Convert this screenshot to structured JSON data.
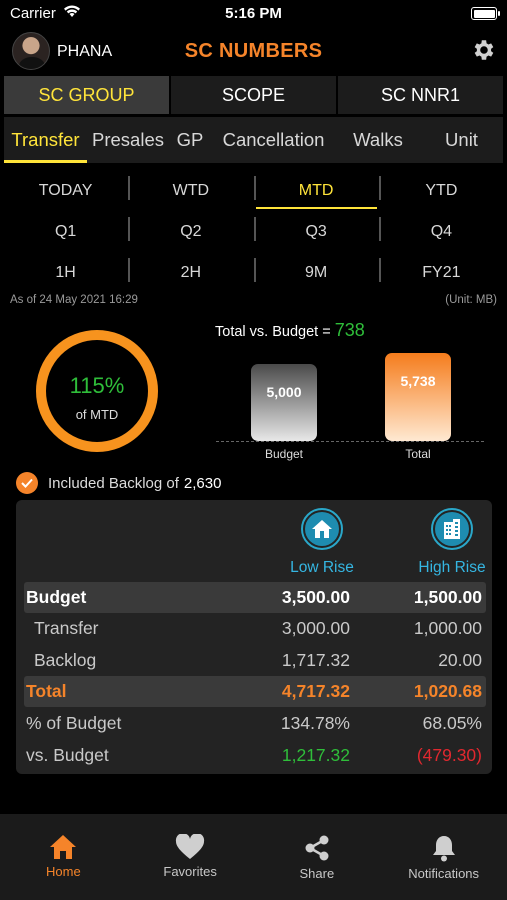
{
  "status_bar": {
    "carrier": "Carrier",
    "time": "5:16 PM"
  },
  "header": {
    "username": "PHANA",
    "title": "SC NUMBERS"
  },
  "group_tabs": [
    "SC GROUP",
    "SCOPE",
    "SC NNR1"
  ],
  "category_tabs": [
    "Transfer",
    "Presales",
    "GP",
    "Cancellation",
    "Walks",
    "Unit"
  ],
  "periods": [
    [
      "TODAY",
      "WTD",
      "MTD",
      "YTD"
    ],
    [
      "Q1",
      "Q2",
      "Q3",
      "Q4"
    ],
    [
      "1H",
      "2H",
      "9M",
      "FY21"
    ]
  ],
  "selected": {
    "group_tab": "SC GROUP",
    "category_tab": "Transfer",
    "period": "MTD"
  },
  "as_of": "As of 24 May 2021 16:29",
  "unit_note": "(Unit: MB)",
  "ring": {
    "percent": "115%",
    "label": "of MTD",
    "value": 1.15
  },
  "total_vs_budget": {
    "label": "Total vs. Budget = ",
    "value": "738"
  },
  "bars": {
    "budget": {
      "label": "Budget",
      "value": "5,000",
      "amount": 5000
    },
    "total": {
      "label": "Total",
      "value": "5,738",
      "amount": 5738
    }
  },
  "backlog_check": {
    "label": "Included Backlog of",
    "value": "2,630",
    "checked": true
  },
  "table": {
    "columns": [
      {
        "label": "Low Rise",
        "icon": "house-icon"
      },
      {
        "label": "High Rise",
        "icon": "building-icon"
      }
    ],
    "rows": [
      {
        "label": "Budget",
        "low": "3,500.00",
        "high": "1,500.00"
      },
      {
        "label": "Transfer",
        "low": "3,000.00",
        "high": "1,000.00"
      },
      {
        "label": "Backlog",
        "low": "1,717.32",
        "high": "20.00"
      },
      {
        "label": "Total",
        "low": "4,717.32",
        "high": "1,020.68"
      },
      {
        "label": "% of Budget",
        "low": "134.78%",
        "high": "68.05%"
      },
      {
        "label": "vs. Budget",
        "low": "1,217.32",
        "high": "(479.30)"
      }
    ]
  },
  "colors": {
    "accent": "#f5842a",
    "selected": "#ffe43a",
    "positive": "#2fbe3a",
    "negative": "#e0282f",
    "info": "#35b6e2"
  },
  "tabbar": [
    {
      "label": "Home",
      "icon": "home-icon"
    },
    {
      "label": "Favorites",
      "icon": "heart-icon"
    },
    {
      "label": "Share",
      "icon": "share-icon"
    },
    {
      "label": "Notifications",
      "icon": "bell-icon"
    }
  ]
}
